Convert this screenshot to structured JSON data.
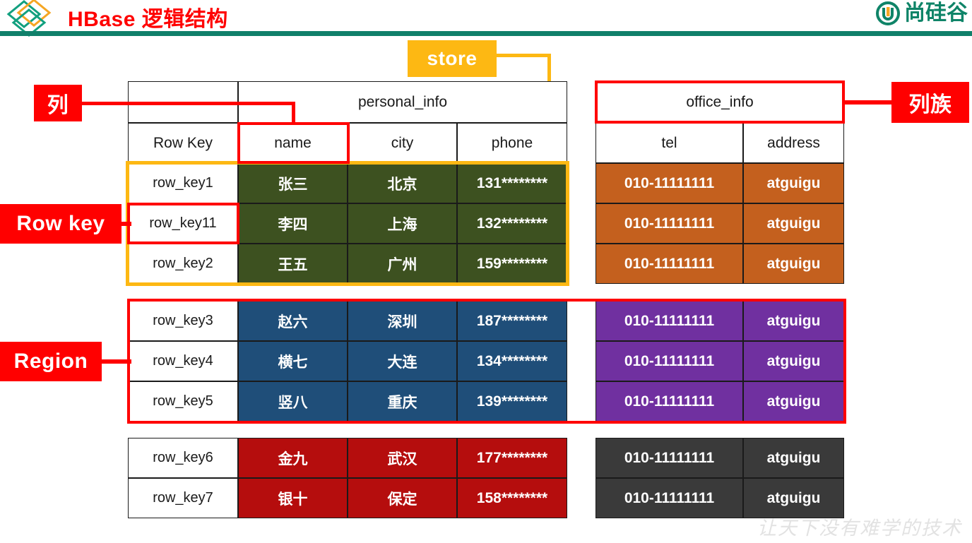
{
  "header": {
    "title": "HBase 逻辑结构",
    "brand_text": "尚硅谷",
    "logo_icon": "diamond-logo-icon",
    "brand_icon": "atguigu-u-circle-icon",
    "rule_color": "#10806a",
    "title_color": "#ff0000",
    "brand_color": "#0f8468"
  },
  "callouts": {
    "store": "store",
    "column": "列",
    "row_key": "Row key",
    "region": "Region",
    "column_family": "列族",
    "store_color": "#fdb813",
    "tag_color": "#ff0000"
  },
  "table": {
    "family_personal": "personal_info",
    "family_office": "office_info",
    "columns": [
      "Row Key",
      "name",
      "city",
      "phone",
      "tel",
      "address"
    ],
    "rows": [
      {
        "row_key": "row_key1",
        "name": "张三",
        "city": "北京",
        "phone": "131********",
        "tel": "010-11111111",
        "address": "atguigu"
      },
      {
        "row_key": "row_key11",
        "name": "李四",
        "city": "上海",
        "phone": "132********",
        "tel": "010-11111111",
        "address": "atguigu"
      },
      {
        "row_key": "row_key2",
        "name": "王五",
        "city": "广州",
        "phone": "159********",
        "tel": "010-11111111",
        "address": "atguigu"
      },
      {
        "row_key": "row_key3",
        "name": "赵六",
        "city": "深圳",
        "phone": "187********",
        "tel": "010-11111111",
        "address": "atguigu"
      },
      {
        "row_key": "row_key4",
        "name": "横七",
        "city": "大连",
        "phone": "134********",
        "tel": "010-11111111",
        "address": "atguigu"
      },
      {
        "row_key": "row_key5",
        "name": "竖八",
        "city": "重庆",
        "phone": "139********",
        "tel": "010-11111111",
        "address": "atguigu"
      },
      {
        "row_key": "row_key6",
        "name": "金九",
        "city": "武汉",
        "phone": "177********",
        "tel": "010-11111111",
        "address": "atguigu"
      },
      {
        "row_key": "row_key7",
        "name": "银十",
        "city": "保定",
        "phone": "158********",
        "tel": "010-11111111",
        "address": "atguigu"
      }
    ],
    "block_colors": {
      "block1_personal": "#3d5120",
      "block1_office": "#c4601e",
      "block2_personal": "#1f4e79",
      "block2_office": "#7030a0",
      "block3_personal": "#b50d0d",
      "block3_office": "#3a3a3a"
    }
  },
  "watermark": "让天下没有难学的技术"
}
